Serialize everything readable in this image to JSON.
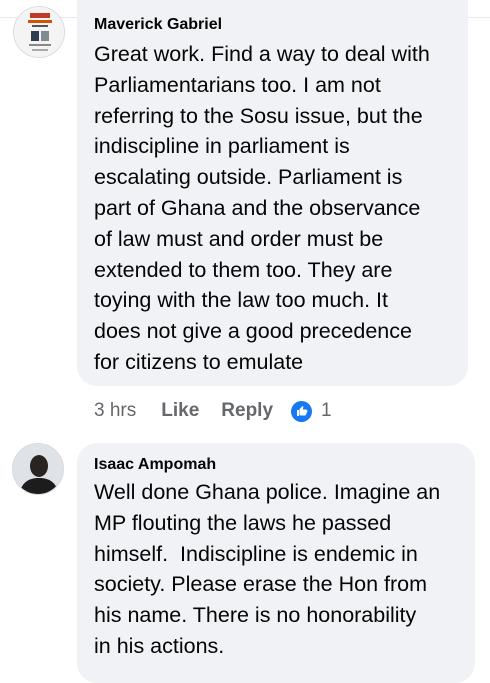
{
  "comments": [
    {
      "author": "Maverick Gabriel",
      "lines": [
        "Great work. Find a way to deal with",
        "Parliamentarians too. I am not",
        "referring to the Sosu issue, but the",
        "indiscipline in parliament is",
        "escalating outside. Parliament is",
        "part of Ghana and the observance",
        "of law must and order must be",
        "extended to them too. They are",
        "toying with the law too much. It",
        "does not give a good precedence",
        "for citizens to emulate"
      ],
      "time": "3 hrs",
      "like_label": "Like",
      "reply_label": "Reply",
      "reaction_count": "1"
    },
    {
      "author": "Isaac Ampomah",
      "lines": [
        "Well done Ghana police. Imagine an",
        "MP flouting the laws he passed",
        "himself.  Indiscipline is endemic in",
        "society. Please erase the Hon from",
        "his name. There is no honorability",
        "in his actions."
      ]
    }
  ],
  "colors": {
    "bubble": "#f0f2f5",
    "text": "#050505",
    "meta": "#65676b",
    "like_blue": "#1877f2"
  },
  "icons": [
    "avatar",
    "like-reaction-icon"
  ]
}
